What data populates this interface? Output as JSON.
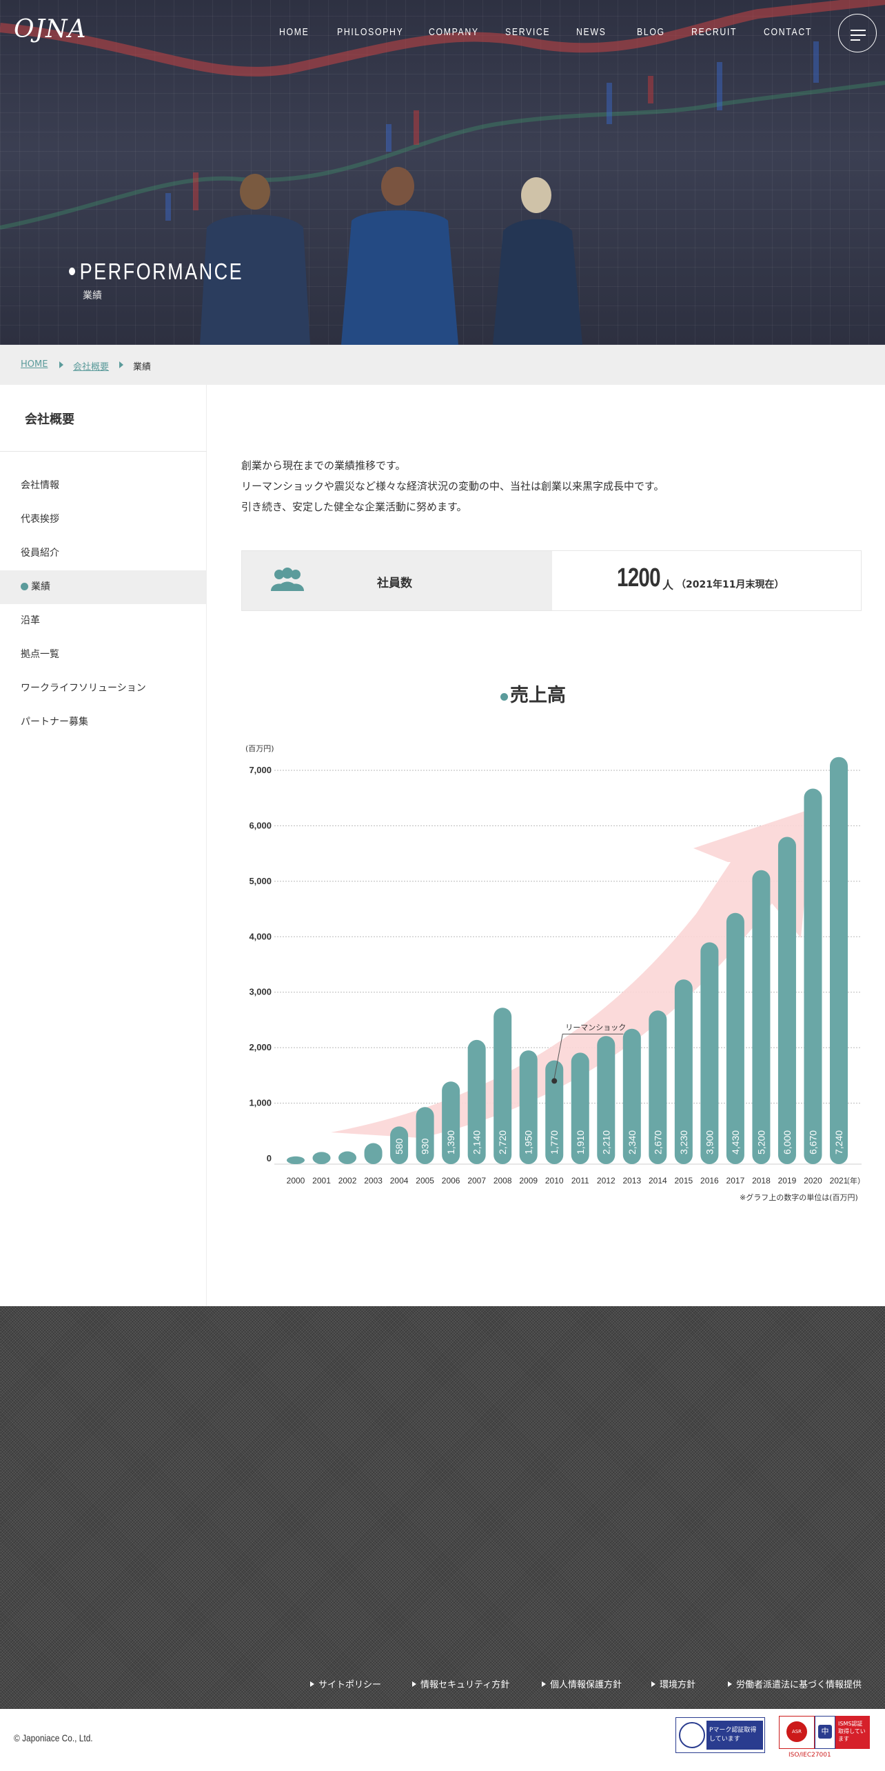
{
  "header": {
    "logo": "OJNA",
    "nav": [
      "HOME",
      "PHILOSOPHY",
      "COMPANY",
      "SERVICE",
      "NEWS",
      "BLOG",
      "RECRUIT",
      "CONTACT"
    ],
    "menu_icon": "hamburger-icon"
  },
  "hero": {
    "title": "PERFORMANCE",
    "subtitle": "業績"
  },
  "breadcrumb": [
    "HOME",
    "会社概要",
    "業績"
  ],
  "sidebar": {
    "heading": "会社概要",
    "items": [
      "会社情報",
      "代表挨拶",
      "役員紹介",
      "業績",
      "沿革",
      "拠点一覧",
      "ワークライフソリューション",
      "パートナー募集"
    ],
    "active": "業績"
  },
  "intro": [
    "創業から現在までの業績推移です。",
    "リーマンショックや震災など様々な経済状況の変動の中、当社は創業以来黒字成長中です。",
    "引き続き、安定した健全な企業活動に努めます。"
  ],
  "employees": {
    "label": "社員数",
    "count": "1200",
    "unit": "人",
    "note": "（2021年11月末現在）"
  },
  "colors": {
    "accent": "#5b9b9b",
    "bar": "#6aa7a6",
    "arrow": "#fbd6d6"
  },
  "chart_data": {
    "type": "bar",
    "title": "売上高",
    "ylabel": "(百万円)",
    "xlabel": "（年）",
    "ylim": [
      0,
      7000
    ],
    "yticks": [
      "0",
      "1,000",
      "2,000",
      "3,000",
      "4,000",
      "5,000",
      "6,000",
      "7,000"
    ],
    "categories": [
      "2000",
      "2001",
      "2002",
      "2003",
      "2004",
      "2005",
      "2006",
      "2007",
      "2008",
      "2009",
      "2010",
      "2011",
      "2012",
      "2013",
      "2014",
      "2015",
      "2016",
      "2017",
      "2018",
      "2019",
      "2020",
      "2021"
    ],
    "values": [
      40,
      120,
      130,
      280,
      580,
      930,
      1390,
      2140,
      2720,
      1950,
      1770,
      1910,
      2210,
      2340,
      2670,
      3230,
      3900,
      4430,
      5200,
      5800,
      6670,
      7240
    ],
    "data_labels": [
      "",
      "",
      "",
      "",
      "580",
      "930",
      "1,390",
      "2,140",
      "2,720",
      "1,950",
      "1,770",
      "1,910",
      "2,210",
      "2,340",
      "2,670",
      "3,230",
      "3,900",
      "4,430",
      "5,200",
      "6,000",
      "6,670",
      "7,240"
    ],
    "annotation": {
      "text": "リーマンショック",
      "category": "2010"
    },
    "footnote": "※グラフ上の数字の単位は(百万円)",
    "grid": true
  },
  "footer": {
    "links": [
      "サイトポリシー",
      "情報セキュリティ方針",
      "個人情報保護方針",
      "環境方針",
      "労働者派遣法に基づく情報提供"
    ],
    "copyright": "© Japoniace Co., Ltd.",
    "badge_p": "Pマーク認証取得しています",
    "badge_isms": "ISMS認証取得しています",
    "badge_asr": "ASR",
    "badge_caption": "ISO/IEC27001"
  }
}
